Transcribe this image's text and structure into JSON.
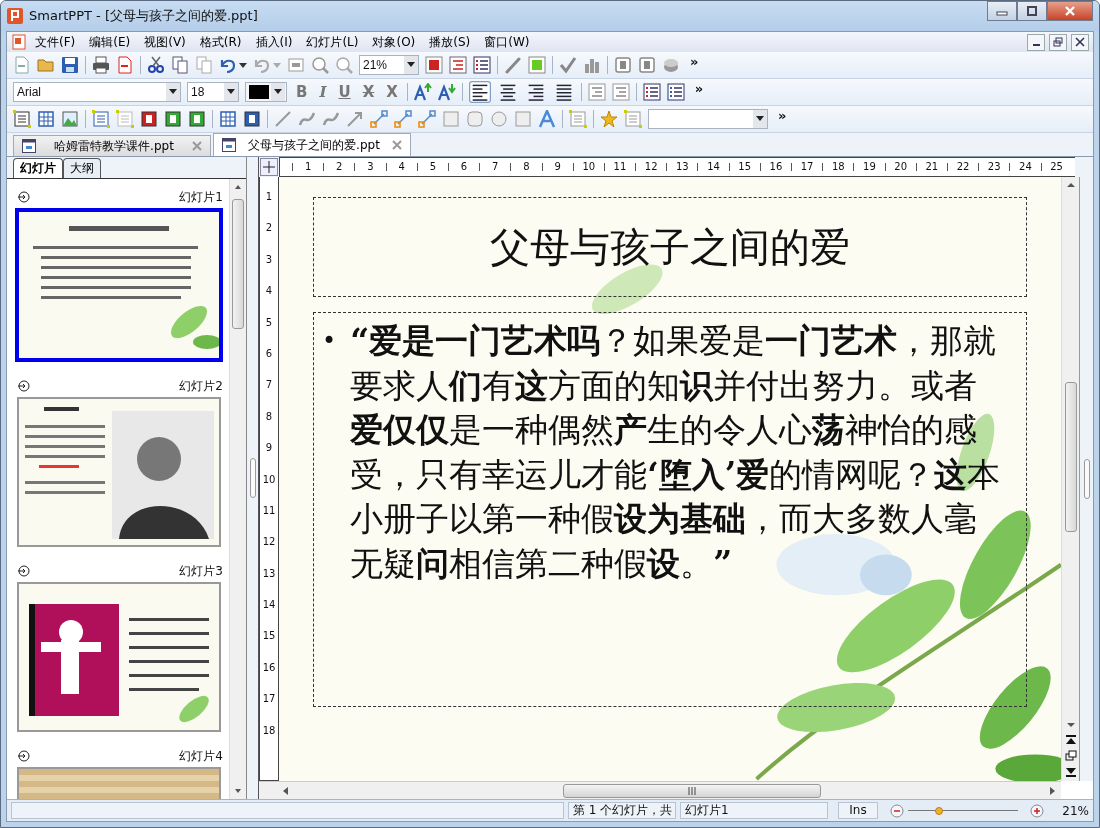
{
  "window": {
    "title": "SmartPPT - [父母与孩子之间的爱.ppt]"
  },
  "menu": [
    "文件(F)",
    "编辑(E)",
    "视图(V)",
    "格式(R)",
    "插入(I)",
    "幻灯片(L)",
    "对象(O)",
    "播放(S)",
    "窗口(W)"
  ],
  "toolbar_1": {
    "zoom": "21%",
    "more": "»"
  },
  "toolbar_2": {
    "font": "Arial",
    "size": "18",
    "more": "»",
    "style_buttons": [
      {
        "label": "B",
        "kind": "bold"
      },
      {
        "label": "I",
        "kind": "italic"
      },
      {
        "label": "U",
        "kind": "underline"
      },
      {
        "label": "X",
        "kind": "strike"
      },
      {
        "label": "X",
        "kind": "plain"
      }
    ],
    "alignment": [
      {
        "kind": "left",
        "selected": true
      },
      {
        "kind": "center",
        "selected": false
      },
      {
        "kind": "right",
        "selected": false
      },
      {
        "kind": "justify",
        "selected": false
      }
    ]
  },
  "toolbar_3": {
    "more": "»"
  },
  "doc_tabs": [
    {
      "label": "哈姆雷特教学课件.ppt",
      "selected": false
    },
    {
      "label": "父母与孩子之间的爱.ppt",
      "selected": true
    }
  ],
  "panel_tabs": [
    {
      "label": "幻灯片",
      "selected": true
    },
    {
      "label": "大纲",
      "selected": false
    }
  ],
  "thumbnails": [
    {
      "label": "幻灯片1",
      "selected": true,
      "kind": "title"
    },
    {
      "label": "幻灯片2",
      "selected": false,
      "kind": "portrait"
    },
    {
      "label": "幻灯片3",
      "selected": false,
      "kind": "book"
    },
    {
      "label": "幻灯片4",
      "selected": false,
      "kind": "brick"
    }
  ],
  "ruler": {
    "horizontal": [
      "1",
      "2",
      "3",
      "4",
      "5",
      "6",
      "7",
      "8",
      "9",
      "10",
      "11",
      "12",
      "13",
      "14",
      "15",
      "16",
      "17",
      "18",
      "19",
      "20",
      "21",
      "22",
      "23",
      "24",
      "25"
    ],
    "vertical": [
      "1",
      "2",
      "3",
      "4",
      "5",
      "6",
      "7",
      "8",
      "9",
      "10",
      "11",
      "12",
      "13",
      "14",
      "15",
      "16",
      "17",
      "18"
    ]
  },
  "slide": {
    "title": "父母与孩子之间的爱",
    "bullet": "•",
    "body": "**“爱是一门艺术吗**？如果爱是**一门艺术**，那就要求人**们**有**这**方面的知**识**并付出努力。或者**爱仅仅**是一种偶然**产**生的令人心**荡**神怡的感受，只有幸运儿才能**‘堕入’爱**的情网呢？**这**本小册子以第一种假**设为基础**，而大多数人毫无疑**问**相信第二种假**设**。**”**"
  },
  "status_bar": {
    "position": "第 1 个幻灯片，共",
    "slide_name": "幻灯片1",
    "mode": "Ins",
    "zoom": "21%",
    "zoom_slider": {
      "level": 0.28
    }
  }
}
